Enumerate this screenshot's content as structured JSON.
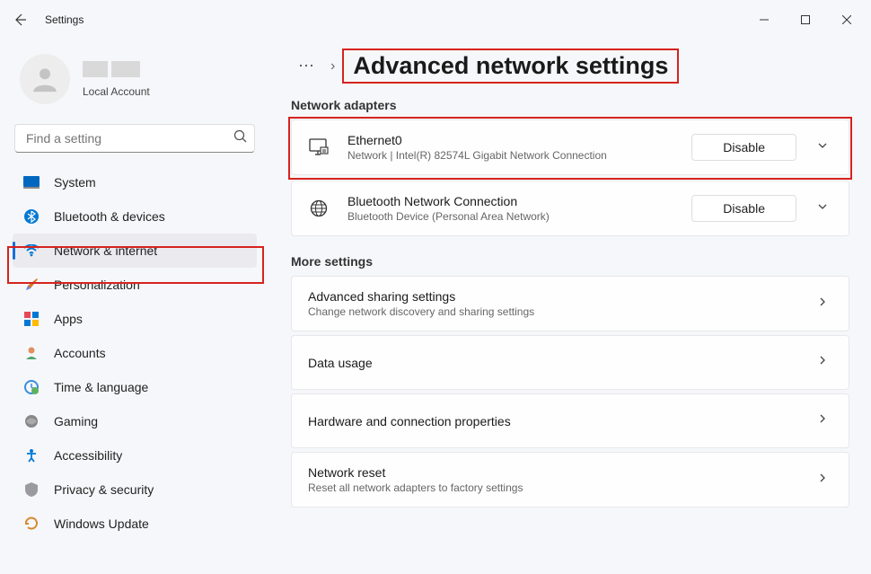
{
  "window": {
    "title": "Settings"
  },
  "profile": {
    "account_type": "Local Account"
  },
  "search": {
    "placeholder": "Find a setting"
  },
  "sidebar": {
    "items": [
      {
        "label": "System"
      },
      {
        "label": "Bluetooth & devices"
      },
      {
        "label": "Network & internet"
      },
      {
        "label": "Personalization"
      },
      {
        "label": "Apps"
      },
      {
        "label": "Accounts"
      },
      {
        "label": "Time & language"
      },
      {
        "label": "Gaming"
      },
      {
        "label": "Accessibility"
      },
      {
        "label": "Privacy & security"
      },
      {
        "label": "Windows Update"
      }
    ]
  },
  "breadcrumb": {
    "ellipsis": "⋯",
    "separator": "›",
    "title": "Advanced network settings"
  },
  "sections": {
    "adapters_label": "Network adapters",
    "more_label": "More settings"
  },
  "adapters": [
    {
      "name": "Ethernet0",
      "detail": "Network | Intel(R) 82574L Gigabit Network Connection",
      "action": "Disable"
    },
    {
      "name": "Bluetooth Network Connection",
      "detail": "Bluetooth Device (Personal Area Network)",
      "action": "Disable"
    }
  ],
  "more_settings": [
    {
      "title": "Advanced sharing settings",
      "sub": "Change network discovery and sharing settings"
    },
    {
      "title": "Data usage",
      "sub": ""
    },
    {
      "title": "Hardware and connection properties",
      "sub": ""
    },
    {
      "title": "Network reset",
      "sub": "Reset all network adapters to factory settings"
    }
  ]
}
